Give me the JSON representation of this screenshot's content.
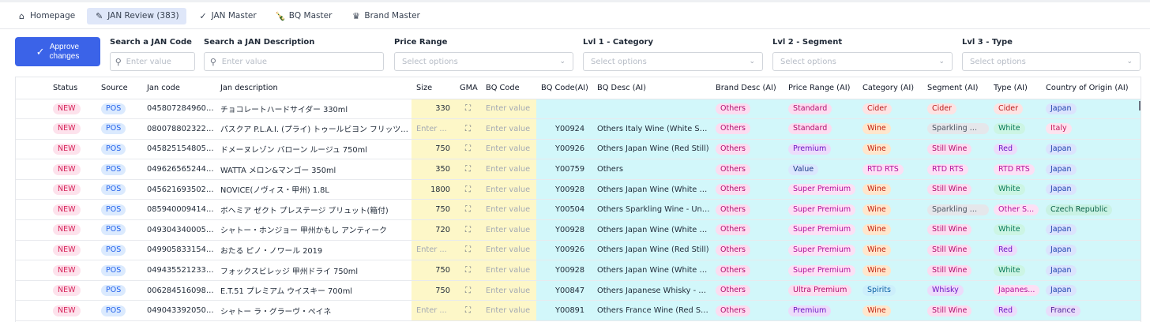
{
  "tabs": [
    {
      "label": "Homepage",
      "icon": "home-icon",
      "glyph": "⌂",
      "active": false
    },
    {
      "label": "JAN Review (383)",
      "icon": "pencil-icon",
      "glyph": "✎",
      "active": true
    },
    {
      "label": "JAN Master",
      "icon": "check-icon",
      "glyph": "✓",
      "active": false
    },
    {
      "label": "BQ Master",
      "icon": "bottle-icon",
      "glyph": "🍾",
      "active": false
    },
    {
      "label": "Brand Master",
      "icon": "crown-icon",
      "glyph": "♛",
      "active": false
    }
  ],
  "toolbar": {
    "approve_label_1": "Approve",
    "approve_label_2": "changes"
  },
  "filters": {
    "jan_code": {
      "label": "Search a JAN Code",
      "placeholder": "Enter value"
    },
    "jan_desc": {
      "label": "Search a JAN Description",
      "placeholder": "Enter value"
    },
    "price_range": {
      "label": "Price Range",
      "placeholder": "Select options"
    },
    "lvl1": {
      "label": "Lvl 1 - Category",
      "placeholder": "Select options"
    },
    "lvl2": {
      "label": "Lvl 2 - Segment",
      "placeholder": "Select options"
    },
    "lvl3": {
      "label": "Lvl 3 - Type",
      "placeholder": "Select options"
    }
  },
  "table": {
    "columns": [
      "Status",
      "Source",
      "Jan code",
      "Jan description",
      "Size",
      "GMA",
      "BQ Code",
      "BQ Code(AI)",
      "BQ Desc (AI)",
      "Brand Desc (AI)",
      "Price Range (AI)",
      "Category (AI)",
      "Segment (AI)",
      "Type (AI)",
      "Country of Origin (AI)"
    ],
    "placeholder": "Enter value",
    "placeholder_short": "Enter ...",
    "rows": [
      {
        "status": "NEW",
        "source": "POS",
        "jan": "04580728496072",
        "desc": "チョコレートハードサイダー 330ml",
        "size": "330",
        "bq_ai": "",
        "bq_desc": "",
        "brand": "Others",
        "price": "Standard",
        "price_c": "pink",
        "cat": "Cider",
        "cat_c": "red",
        "seg": "Cider",
        "seg_c": "red",
        "type": "Cider",
        "type_c": "red",
        "country": "Japan",
        "country_c": "jp"
      },
      {
        "status": "NEW",
        "source": "POS",
        "jan": "08007880232202",
        "desc": "パスクア P.L.A.I. (プライ) トゥールビヨン フリッツァ...",
        "size": "",
        "bq_ai": "Y00924",
        "bq_desc": "Others Italy Wine (White Sparkli...",
        "brand": "Others",
        "price": "Standard",
        "price_c": "pink",
        "cat": "Wine",
        "cat_c": "org",
        "seg": "Sparkling Wi...",
        "seg_c": "gray",
        "type": "White",
        "type_c": "green",
        "country": "Italy",
        "country_c": "it"
      },
      {
        "status": "NEW",
        "source": "POS",
        "jan": "04582515480509",
        "desc": "ドメーヌレゾン バローン ルージュ 750ml",
        "size": "750",
        "bq_ai": "Y00926",
        "bq_desc": "Others Japan Wine (Red Still)",
        "brand": "Others",
        "price": "Premium",
        "price_c": "purple",
        "cat": "Wine",
        "cat_c": "org",
        "seg": "Still Wine",
        "seg_c": "pink",
        "type": "Red",
        "type_c": "purple",
        "country": "Japan",
        "country_c": "jp"
      },
      {
        "status": "NEW",
        "source": "POS",
        "jan": "04962656524414",
        "desc": "WATTA メロン&マンゴー 350ml",
        "size": "350",
        "bq_ai": "Y00759",
        "bq_desc": "Others",
        "brand": "Others",
        "price": "Value",
        "price_c": "blue",
        "cat": "RTD RTS",
        "cat_c": "mag",
        "seg": "RTD RTS",
        "seg_c": "mag",
        "type": "RTD RTS",
        "type_c": "mag",
        "country": "Japan",
        "country_c": "jp"
      },
      {
        "status": "NEW",
        "source": "POS",
        "jan": "04562169350212",
        "desc": "NOVICE(ノヴィス・甲州) 1.8L",
        "size": "1800",
        "bq_ai": "Y00928",
        "bq_desc": "Others Japan Wine (White Still)",
        "brand": "Others",
        "price": "Super Premium",
        "price_c": "mag",
        "cat": "Wine",
        "cat_c": "org",
        "seg": "Still Wine",
        "seg_c": "pink",
        "type": "White",
        "type_c": "green",
        "country": "Japan",
        "country_c": "jp"
      },
      {
        "status": "NEW",
        "source": "POS",
        "jan": "08594000941453",
        "desc": "ボヘミア ゼクト プレステージ ブリュット(箱付)",
        "size": "750",
        "bq_ai": "Y00504",
        "bq_desc": "Others Sparkling Wine - Unkno...",
        "brand": "Others",
        "price": "Super Premium",
        "price_c": "mag",
        "cat": "Wine",
        "cat_c": "org",
        "seg": "Sparkling Wi...",
        "seg_c": "gray",
        "type": "Other S...",
        "type_c": "mag",
        "country": "Czech Republic",
        "country_c": "cz"
      },
      {
        "status": "NEW",
        "source": "POS",
        "jan": "04930434000511",
        "desc": "シャトー・ホンジョー 甲州かもし アンティーク",
        "size": "720",
        "bq_ai": "Y00928",
        "bq_desc": "Others Japan Wine (White Still)",
        "brand": "Others",
        "price": "Super Premium",
        "price_c": "mag",
        "cat": "Wine",
        "cat_c": "org",
        "seg": "Still Wine",
        "seg_c": "pink",
        "type": "White",
        "type_c": "green",
        "country": "Japan",
        "country_c": "jp"
      },
      {
        "status": "NEW",
        "source": "POS",
        "jan": "04990583315485",
        "desc": "おたる ピノ・ノワール 2019",
        "size": "",
        "bq_ai": "Y00926",
        "bq_desc": "Others Japan Wine (Red Still)",
        "brand": "Others",
        "price": "Super Premium",
        "price_c": "mag",
        "cat": "Wine",
        "cat_c": "org",
        "seg": "Still Wine",
        "seg_c": "pink",
        "type": "Red",
        "type_c": "purple",
        "country": "Japan",
        "country_c": "jp"
      },
      {
        "status": "NEW",
        "source": "POS",
        "jan": "04943552123314",
        "desc": "フォックスビレッジ 甲州ドライ 750ml",
        "size": "750",
        "bq_ai": "Y00928",
        "bq_desc": "Others Japan Wine (White Still)",
        "brand": "Others",
        "price": "Super Premium",
        "price_c": "mag",
        "cat": "Wine",
        "cat_c": "org",
        "seg": "Still Wine",
        "seg_c": "pink",
        "type": "White",
        "type_c": "green",
        "country": "Japan",
        "country_c": "jp"
      },
      {
        "status": "NEW",
        "source": "POS",
        "jan": "00628451609827",
        "desc": "E.T.51 プレミアム ウイスキー 700ml",
        "size": "750",
        "bq_ai": "Y00847",
        "bq_desc": "Others Japanese Whisky - Ultra ...",
        "brand": "Others",
        "price": "Ultra Premium",
        "price_c": "pink",
        "cat": "Spirits",
        "cat_c": "cyan",
        "seg": "Whisky",
        "seg_c": "purple",
        "type": "Japanes...",
        "type_c": "mag",
        "country": "Japan",
        "country_c": "jp"
      },
      {
        "status": "NEW",
        "source": "POS",
        "jan": "04904339205005",
        "desc": "シャトー ラ・グラーヴ・ペイネ",
        "size": "",
        "bq_ai": "Y00891",
        "bq_desc": "Others France Wine (Red Still)",
        "brand": "Others",
        "price": "Premium",
        "price_c": "purple",
        "cat": "Wine",
        "cat_c": "org",
        "seg": "Still Wine",
        "seg_c": "pink",
        "type": "Red",
        "type_c": "purple",
        "country": "France",
        "country_c": "fr"
      }
    ]
  }
}
